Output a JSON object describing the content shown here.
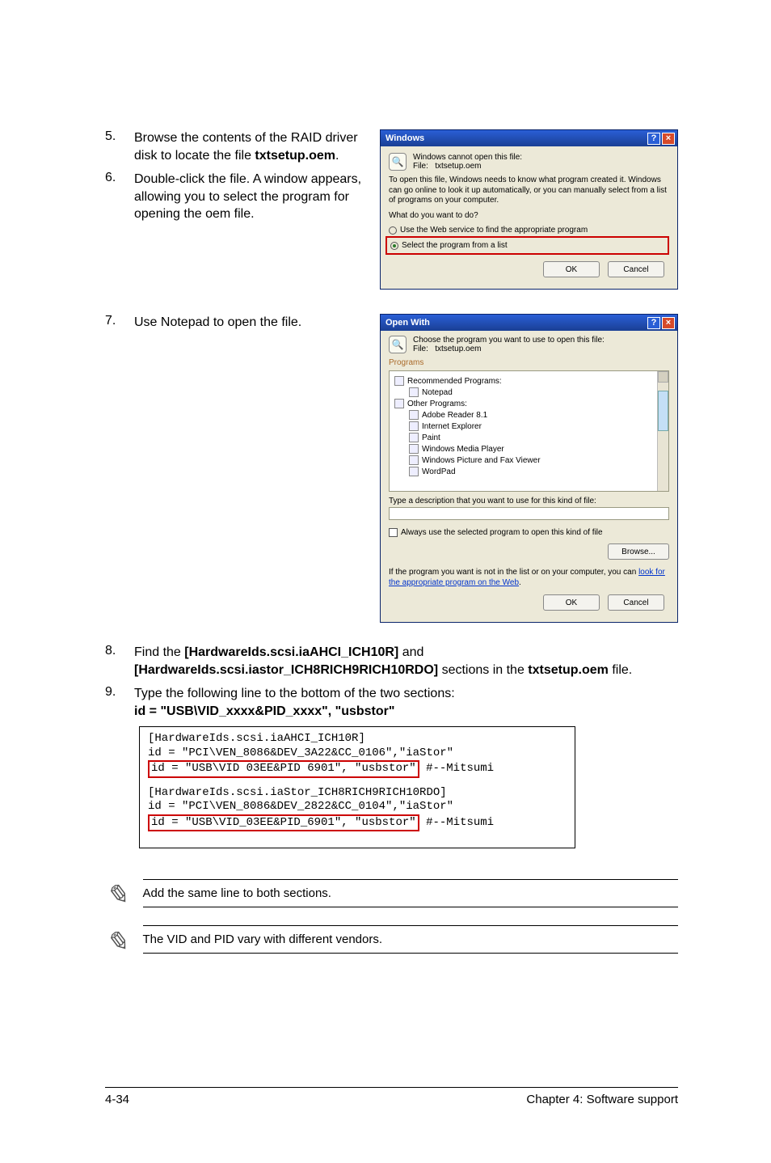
{
  "steps": {
    "s5": {
      "num": "5.",
      "text_a": "Browse the contents of the RAID driver disk to locate the file ",
      "bold_a": "txtsetup.oem",
      "text_b": "."
    },
    "s6": {
      "num": "6.",
      "text": "Double-click the file. A window appears, allowing you to select the program for opening the oem file."
    },
    "s7": {
      "num": "7.",
      "text": "Use Notepad to open the file."
    },
    "s8": {
      "num": "8.",
      "text_a": "Find the ",
      "bold_a": "[HardwareIds.scsi.iaAHCI_ICH10R]",
      "text_b": " and ",
      "bold_b": "[HardwareIds.scsi.iastor_ICH8RICH9RICH10RDO]",
      "text_c": " sections in the ",
      "bold_c": "txtsetup.oem",
      "text_d": " file."
    },
    "s9": {
      "num": "9.",
      "text": "Type the following line to the bottom of the two sections:",
      "bold": "id = \"USB\\VID_xxxx&PID_xxxx\", \"usbstor\""
    }
  },
  "dialog1": {
    "title": "Windows",
    "line1": "Windows cannot open this file:",
    "file_label": "File:",
    "file_name": "txtsetup.oem",
    "para": "To open this file, Windows needs to know what program created it. Windows can go online to look it up automatically, or you can manually select from a list of programs on your computer.",
    "question": "What do you want to do?",
    "opt1": "Use the Web service to find the appropriate program",
    "opt2": "Select the program from a list",
    "ok": "OK",
    "cancel": "Cancel"
  },
  "dialog2": {
    "title": "Open With",
    "line1": "Choose the program you want to use to open this file:",
    "file_label": "File:",
    "file_name": "txtsetup.oem",
    "tab": "Programs",
    "cat1": "Recommended Programs:",
    "items1": [
      "Notepad"
    ],
    "cat2": "Other Programs:",
    "items2": [
      "Adobe Reader 8.1",
      "Internet Explorer",
      "Paint",
      "Windows Media Player",
      "Windows Picture and Fax Viewer",
      "WordPad"
    ],
    "typedesc": "Type a description that you want to use for this kind of file:",
    "chk": "Always use the selected program to open this kind of file",
    "browse": "Browse...",
    "link_a": "If the program you want is not in the list or on your computer, you can ",
    "link_text": "look for the appropriate program on the Web",
    "link_b": ".",
    "ok": "OK",
    "cancel": "Cancel"
  },
  "code": {
    "l1": "[HardwareIds.scsi.iaAHCI_ICH10R]",
    "l2": "id = \"PCI\\VEN_8086&DEV_3A22&CC_0106\",\"iaStor\"",
    "l3a": "id = \"USB\\VID 03EE&PID 6901\", \"usbstor\"",
    "l3b": "#--Mitsumi",
    "l4": "[HardwareIds.scsi.iaStor_ICH8RICH9RICH10RDO]",
    "l5": "id = \"PCI\\VEN_8086&DEV_2822&CC_0104\",\"iaStor\"",
    "l6a": "id = \"USB\\VID_03EE&PID_6901\", \"usbstor\"",
    "l6b": "#--Mitsumi"
  },
  "notes": {
    "n1": "Add the same line to both sections.",
    "n2": "The VID and PID vary with different vendors."
  },
  "footer": {
    "left": "4-34",
    "right": "Chapter 4: Software support"
  }
}
